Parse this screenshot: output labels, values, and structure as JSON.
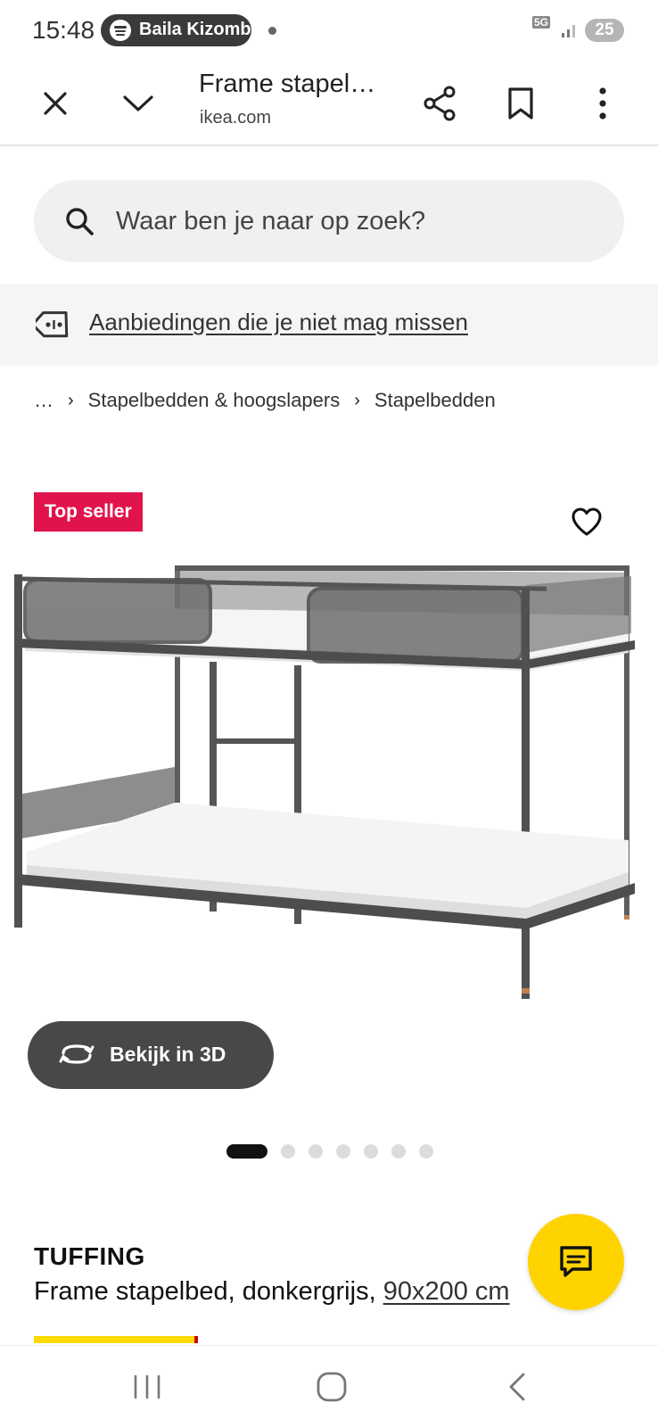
{
  "status_bar": {
    "time": "15:48",
    "media_title": "Baila Kizomba",
    "network": "5G",
    "battery": "25"
  },
  "browser": {
    "page_title": "Frame stapel…",
    "domain": "ikea.com",
    "icons": [
      "close-icon",
      "chevron-down-icon",
      "share-icon",
      "bookmark-icon",
      "more-vert-icon"
    ]
  },
  "search": {
    "placeholder": "Waar ben je naar op zoek?",
    "value": ""
  },
  "offers": {
    "label": "Aanbiedingen die je niet mag missen"
  },
  "breadcrumb": {
    "ellipsis": "…",
    "items": [
      "Stapelbedden & hoogslapers",
      "Stapelbedden"
    ]
  },
  "product": {
    "badge": "Top seller",
    "view_3d": "Bekijk in 3D",
    "name": "TUFFING",
    "description": "Frame stapelbed, donkergrijs, ",
    "size": "90x200 cm",
    "image_count": 7,
    "active_image": 1
  },
  "colors": {
    "badge": "#e0144b",
    "fab": "#ffd300",
    "price_accent": "#ffdb00"
  }
}
